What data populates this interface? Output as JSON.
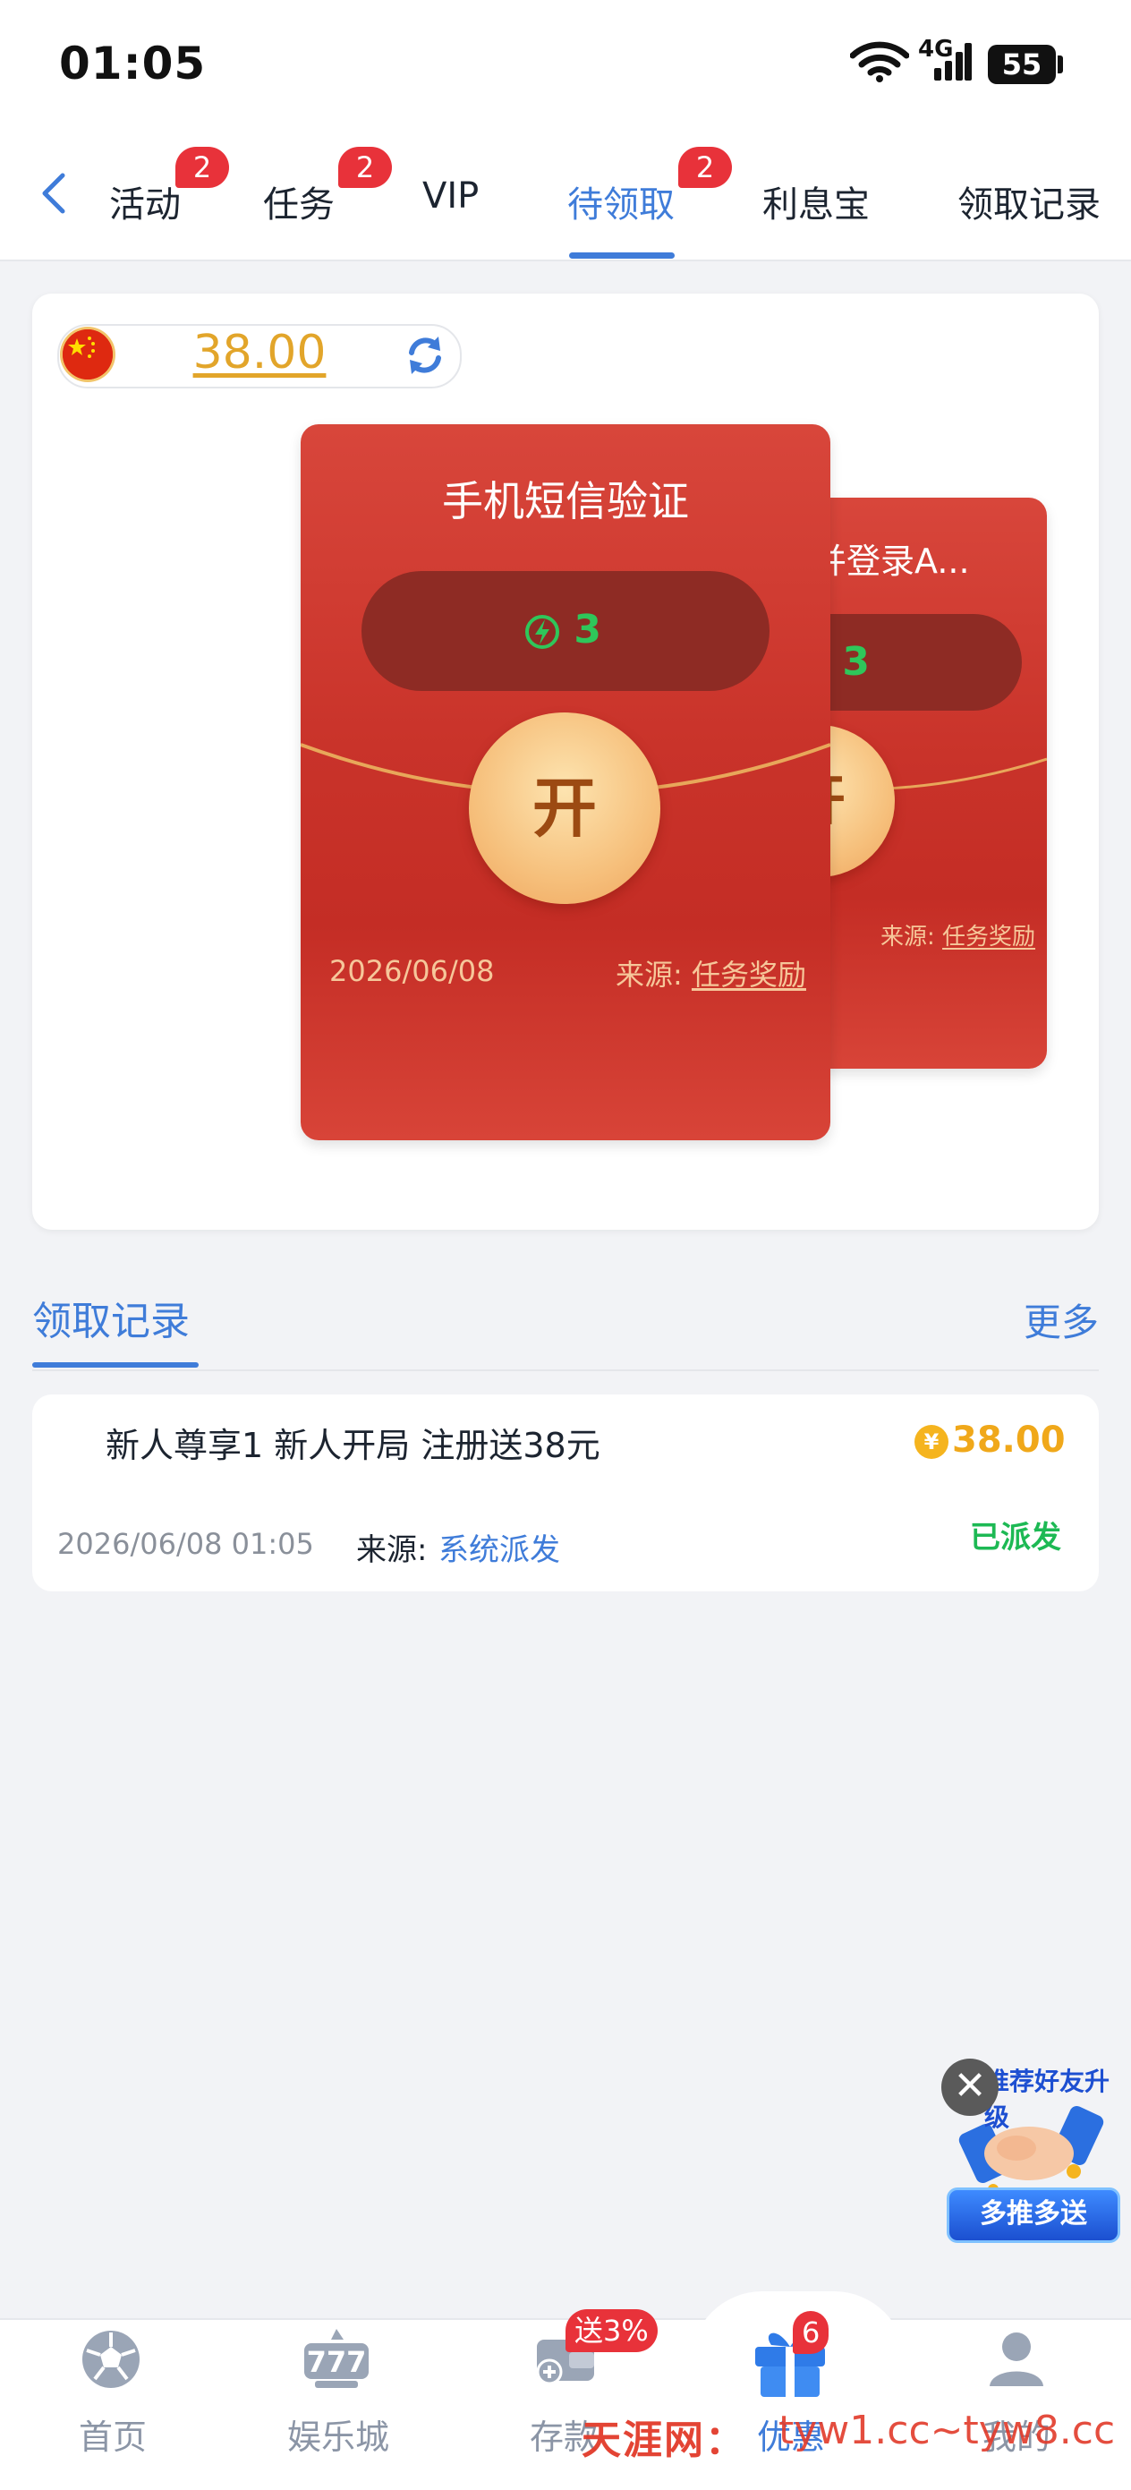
{
  "status_bar": {
    "time": "01:05",
    "network": "4G",
    "battery": "55"
  },
  "tabs": [
    {
      "label": "活动",
      "badge": "2"
    },
    {
      "label": "任务",
      "badge": "2"
    },
    {
      "label": "VIP",
      "badge": ""
    },
    {
      "label": "待领取",
      "badge": "2",
      "active": true
    },
    {
      "label": "利息宝",
      "badge": ""
    },
    {
      "label": "领取记录",
      "badge": ""
    }
  ],
  "balance": {
    "value": "38.00"
  },
  "envelopes": [
    {
      "title": "手机短信验证",
      "energy": "3",
      "open_label": "开",
      "date": "2026/06/08",
      "source_label": "来源:",
      "source": "任务奖励"
    },
    {
      "title": "装并登录A...",
      "energy": "3",
      "open_label": "开",
      "source_label": "来源:",
      "source": "任务奖励"
    }
  ],
  "records": {
    "title": "领取记录",
    "more": "更多",
    "items": [
      {
        "title": "新人尊享1 新人开局 注册送38元",
        "coin_symbol": "¥",
        "amount": "38.00",
        "date": "2026/06/08 01:05",
        "source_label": "来源:",
        "source": "系统派发",
        "status": "已派发"
      }
    ]
  },
  "promo": {
    "top_text": "推荐好友升级",
    "button": "多推多送",
    "close": "✕"
  },
  "bottom_nav": [
    {
      "label": "首页",
      "icon": "soccer-ball-icon"
    },
    {
      "label": "娱乐城",
      "icon": "slot-777-icon"
    },
    {
      "label": "存款",
      "icon": "wallet-plus-icon",
      "badge": "送3%"
    },
    {
      "label": "优惠",
      "icon": "gift-icon",
      "badge": "6",
      "active": true
    },
    {
      "label": "我的",
      "icon": "user-icon"
    }
  ],
  "watermark": {
    "text": "天涯网：",
    "url": "tyw1.cc~tyw8.cc"
  },
  "colors": {
    "accent": "#3f7cd9",
    "badge": "#e8323a",
    "envelope": "#c9332a",
    "gold": "#f0a81a",
    "success": "#1db954"
  }
}
